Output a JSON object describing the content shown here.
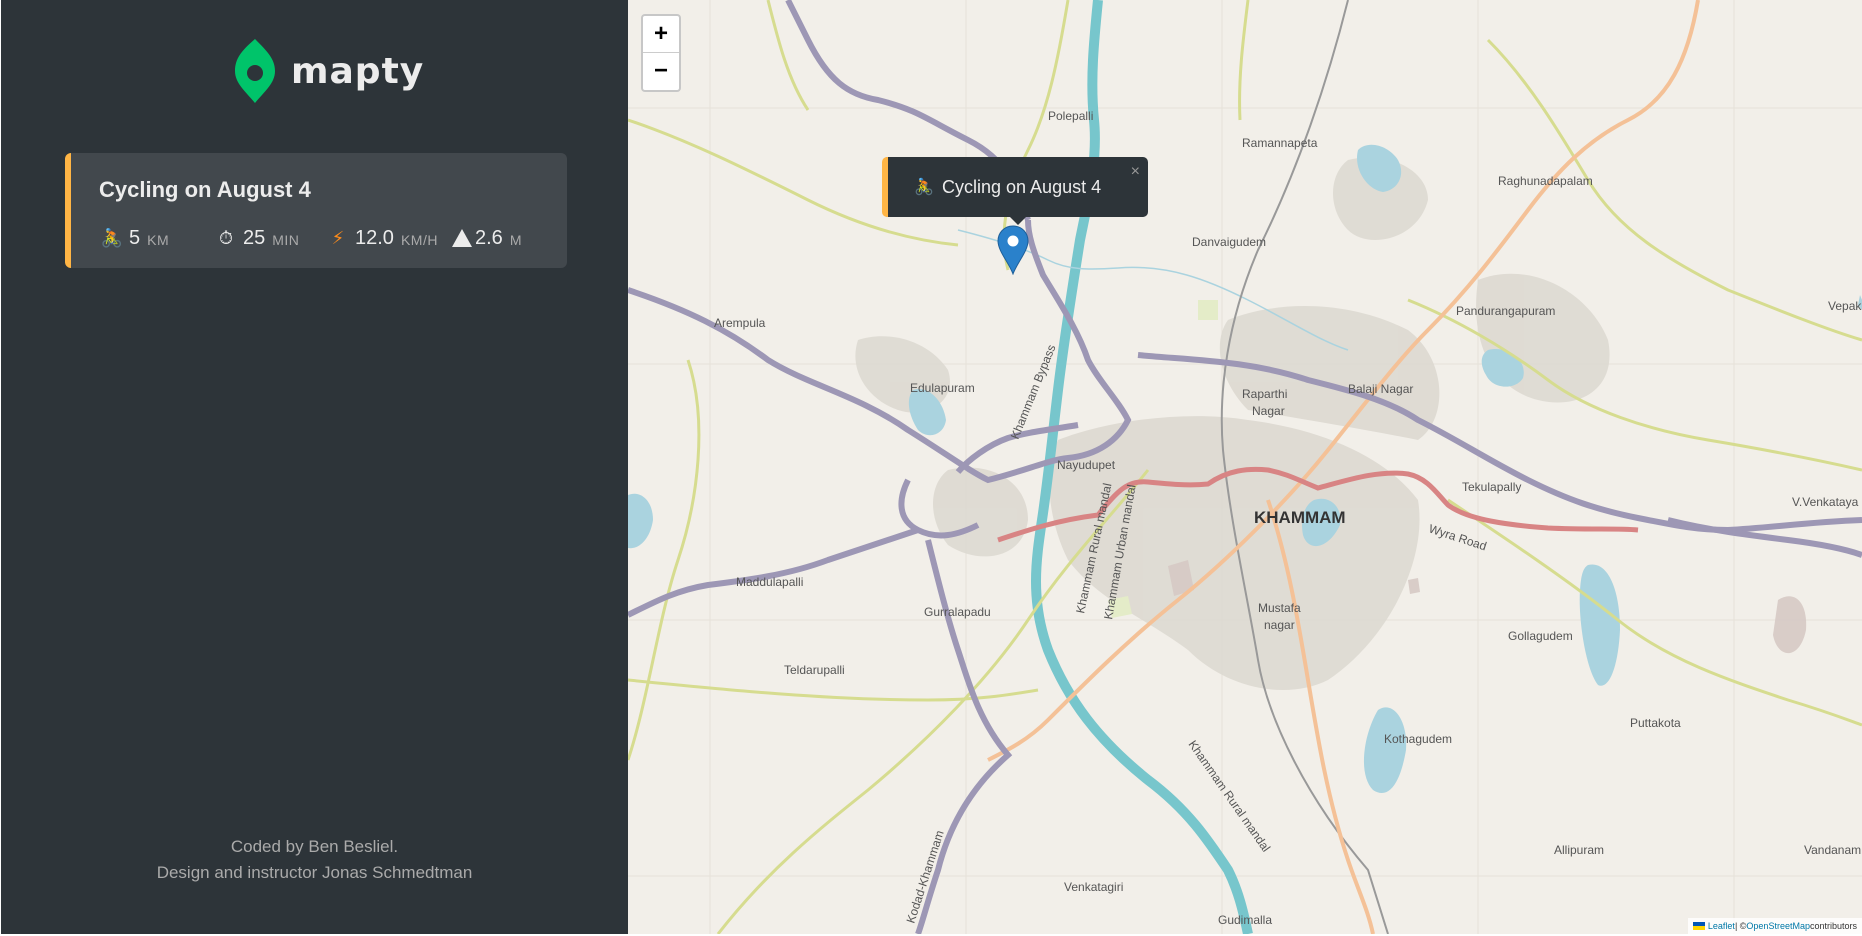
{
  "sidebar": {
    "logo_text": "mapty",
    "workout": {
      "title": "Cycling on August 4",
      "distance_icon": "🚴",
      "distance": "5",
      "distance_unit": "km",
      "duration_icon": "⏱",
      "duration": "25",
      "duration_unit": "min",
      "speed_icon": "⚡",
      "speed": "12.0",
      "speed_unit": "km/h",
      "elevation_icon": "⛰",
      "elevation": "2.6",
      "elevation_unit": "m"
    },
    "copyright": {
      "line1": "Coded by Ben Besliel.",
      "line2": "Design and instructor Jonas Schmedtman"
    }
  },
  "map": {
    "zoom_in": "+",
    "zoom_out": "−",
    "popup": {
      "icon": "🚴",
      "text": "Cycling on August 4",
      "close": "×"
    },
    "attribution": {
      "leaflet": "Leaflet",
      "sep": " | © ",
      "osm": "OpenStreetMap",
      "suffix": " contributors"
    },
    "labels": {
      "khammam": "KHAMMAM",
      "polepalli": "Polepalli",
      "ramannapeta": "Ramannapeta",
      "raghunadapalam": "Raghunadapalam",
      "danvaigudem": "Danvaigudem",
      "pandurangapuram": "Pandurangapuram",
      "arempula": "Arempula",
      "edulapuram": "Edulapuram",
      "raparthi": "Raparthi",
      "nagar": "Nagar",
      "balaji_nagar": "Balaji Nagar",
      "nayudupet": "Nayudupet",
      "tekulapally": "Tekulapally",
      "wyra_road": "Wyra Road",
      "v_venkataya": "V.Venkataya",
      "vepak": "Vepak",
      "maddulapalli": "Maddulapalli",
      "gurralapadu": "Gurralapadu",
      "mustafa": "Mustafa",
      "mustafa_nagar": "nagar",
      "gollagudem": "Gollagudem",
      "teldarupalli": "Teldarupalli",
      "puttakota": "Puttakota",
      "kothagudem": "Kothagudem",
      "allipuram": "Allipuram",
      "vandanam": "Vandanam",
      "venkatagiri": "Venkatagiri",
      "gudimalla": "Gudimalla",
      "khammam_bypass": "Khammam Bypass",
      "khammam_rural": "Khammam Rural mandal",
      "khammam_urban": "Khammam Urban mandal",
      "khammam_rural2": "Khammam Rural mandal",
      "kodad_khammam": "Kodad-Khammam"
    },
    "colors": {
      "water": "#aad3df",
      "river": "#77c6cc",
      "highway_purple": "#9d97b5",
      "road_red": "#d88484",
      "road_orange": "#f4c197",
      "road_yellow": "#d6dc8f",
      "urban": "#dcd8d0",
      "marker": "#2a81cb"
    }
  }
}
